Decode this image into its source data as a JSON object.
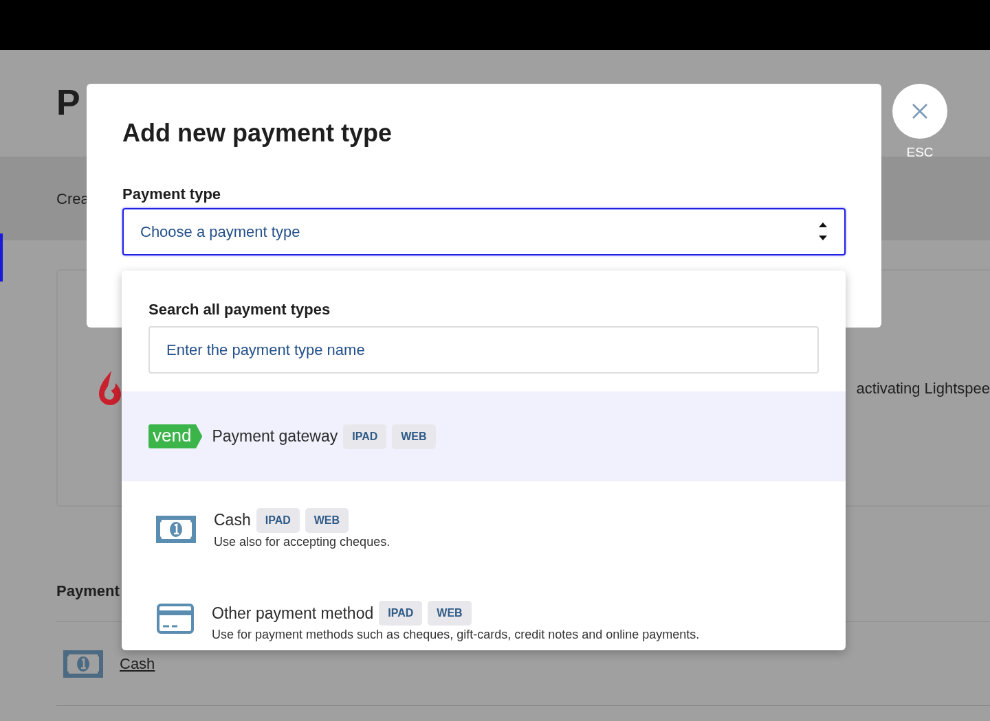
{
  "page": {
    "title": "P",
    "subtitle": "Crea",
    "card_text": "activating Lightspee",
    "section_heading": "Payment",
    "payment_rows": [
      {
        "name": "Cash"
      }
    ]
  },
  "modal": {
    "title": "Add new payment type",
    "field_label": "Payment type",
    "select": {
      "placeholder": "Choose a payment type",
      "expanded": true
    },
    "close": {
      "label": "ESC"
    }
  },
  "dropdown": {
    "search_label": "Search all payment types",
    "search": {
      "placeholder": "Enter the payment type name"
    },
    "options": [
      {
        "kind": "gateway",
        "logo_text": "vend",
        "name": "Payment gateway",
        "tags": [
          "IPAD",
          "WEB"
        ],
        "selected": true
      },
      {
        "kind": "cash",
        "name": "Cash",
        "description": "Use also for accepting cheques.",
        "tags": [
          "IPAD",
          "WEB"
        ],
        "selected": false
      },
      {
        "kind": "other",
        "name": "Other payment method",
        "description": "Use for payment methods such as cheques, gift-cards, credit notes and online payments.",
        "tags": [
          "IPAD",
          "WEB"
        ],
        "selected": false
      }
    ]
  }
}
